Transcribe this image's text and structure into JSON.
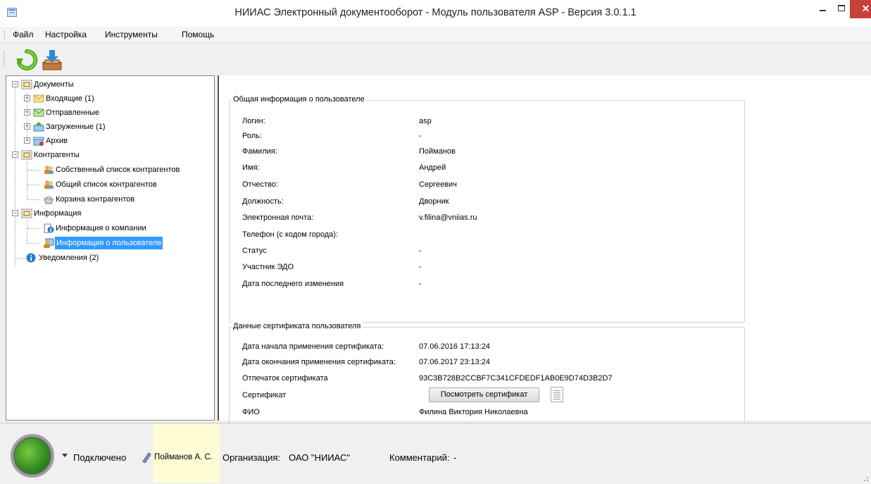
{
  "window": {
    "title": "НИИАС Электронный документооборот - Модуль пользователя ASP - Версия 3.0.1.1",
    "close_glyph": "✕"
  },
  "menu": {
    "items": [
      "Файл",
      "Настройка",
      "Инструменты",
      "Помощь"
    ]
  },
  "toolbar": {
    "buttons": [
      {
        "icon": "refresh-icon"
      },
      {
        "icon": "download-inbox-icon"
      }
    ]
  },
  "tree": {
    "documents": {
      "label": "Документы",
      "children": [
        "Входящие (1)",
        "Отправленные",
        "Загруженные (1)",
        "Архив"
      ]
    },
    "contractors": {
      "label": "Контрагенты",
      "children": [
        "Собственный список контрагентов",
        "Общий список контрагентов",
        "Корзина контрагентов"
      ]
    },
    "information": {
      "label": "Информация",
      "children": [
        "Информация о компании",
        "Информация о пользователе"
      ]
    },
    "notifications": "Уведомления (2)",
    "selected": "Информация о пользователе"
  },
  "user_info": {
    "title": "Общая информация о пользователе",
    "rows": [
      {
        "label": "Логин:",
        "value": "asp"
      },
      {
        "label": "Роль:",
        "value": "-"
      },
      {
        "label": "Фамилия:",
        "value": "Пойманов"
      },
      {
        "label": "Имя:",
        "value": "Андрей"
      },
      {
        "label": "Отчество:",
        "value": "Сергеевич"
      },
      {
        "label": "Должность:",
        "value": "Дворник"
      },
      {
        "label": "Электронная почта:",
        "value": "v.filina@vniias.ru"
      },
      {
        "label": "Телефон (с кодом города):",
        "value": ""
      },
      {
        "label": "Статус",
        "value": "-"
      },
      {
        "label": "Участник ЭДО",
        "value": "-"
      },
      {
        "label": "Дата последнего изменения",
        "value": "-"
      }
    ]
  },
  "certificate": {
    "title": "Данные сертификата пользователя",
    "rows": [
      {
        "label": "Дата начала применения сертификата:",
        "value": "07.06.2016 17:13:24"
      },
      {
        "label": "Дата окончания применения сертификата:",
        "value": "07.06.2017 23:13:24"
      },
      {
        "label": "Отпечаток сертификата",
        "value": "93C3B728B2CCBF7C341CFDEDF1AB0E9D74D3B2D7"
      },
      {
        "label": "Сертификат",
        "button": "Посмотреть сертификат"
      },
      {
        "label": "ФИО",
        "value": "Филина Виктория Николаевна"
      }
    ]
  },
  "status": {
    "connection": "Подключено",
    "user": "Пойманов А. С.",
    "org_label": "Организация:",
    "org_value": "ОАО \"НИИАС\"",
    "comment_label": "Комментарий:",
    "comment_value": "-",
    "indicator_color": "#3a9a2a"
  }
}
